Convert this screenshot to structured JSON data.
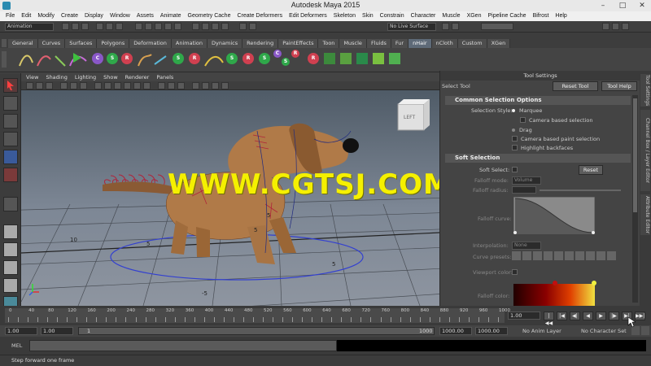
{
  "window": {
    "title": "Autodesk Maya 2015",
    "minimize": "–",
    "maximize": "□",
    "close": "✕"
  },
  "menubar": [
    "File",
    "Edit",
    "Modify",
    "Create",
    "Display",
    "Window",
    "Assets",
    "Animate",
    "Geometry Cache",
    "Create Deformers",
    "Edit Deformers",
    "Skeleton",
    "Skin",
    "Constrain",
    "Character",
    "Muscle",
    "XGen",
    "Pipeline Cache",
    "Bifrost",
    "Help"
  ],
  "statusline": {
    "menuset": "Animation",
    "live_surface": "No Live Surface"
  },
  "shelf": {
    "tabs": [
      "General",
      "Curves",
      "Surfaces",
      "Polygons",
      "Deformation",
      "Animation",
      "Dynamics",
      "Rendering",
      "PaintEffects",
      "Toon",
      "Muscle",
      "Fluids",
      "Fur",
      "nHair",
      "nCloth",
      "Custom",
      "XGen"
    ],
    "active_tab": "nHair",
    "icon_letters": [
      "C",
      "S",
      "R",
      "S",
      "R",
      "S",
      "R",
      "S",
      "C",
      "S",
      "R",
      "R"
    ]
  },
  "viewport": {
    "menu": [
      "View",
      "Shading",
      "Lighting",
      "Show",
      "Renderer",
      "Panels"
    ],
    "viewcube_label": "LEFT",
    "grid_labels": [
      "10",
      "5",
      "5",
      "-5",
      "5",
      "5"
    ],
    "watermark": "WWW.CGTSJ.COM"
  },
  "tool_settings": {
    "panel_title": "Tool Settings",
    "tool_name": "Select Tool",
    "reset_tool": "Reset Tool",
    "tool_help": "Tool Help",
    "common_section": "Common Selection Options",
    "selection_style_label": "Selection Style:",
    "marquee": "Marquee",
    "camera_based_selection": "Camera based selection",
    "drag": "Drag",
    "camera_based_paint": "Camera based paint selection",
    "highlight_backfaces": "Highlight backfaces",
    "soft_section": "Soft Selection",
    "soft_select": "Soft Select:",
    "reset": "Reset",
    "falloff_mode": "Falloff mode:",
    "falloff_mode_value": "Volume",
    "falloff_radius": "Falloff radius:",
    "falloff_curve": "Falloff curve:",
    "interpolation": "Interpolation:",
    "interpolation_value": "None",
    "curve_presets": "Curve presets:",
    "viewport_color": "Viewport color:",
    "falloff_color": "Falloff color:"
  },
  "side_tabs": [
    "Tool Settings",
    "Channel Box / Layer Editor",
    "Attribute Editor"
  ],
  "timeline": {
    "ticks": [
      "0",
      "20",
      "40",
      "60",
      "80",
      "100",
      "120",
      "140",
      "160",
      "180",
      "200",
      "220",
      "240",
      "260",
      "280",
      "300",
      "320",
      "340",
      "360",
      "380",
      "400",
      "420",
      "440",
      "460",
      "480",
      "500",
      "520",
      "540",
      "560",
      "580",
      "600",
      "620",
      "640",
      "660",
      "680",
      "700",
      "720",
      "740",
      "760",
      "780",
      "800",
      "820",
      "840",
      "860",
      "880",
      "900",
      "920",
      "940",
      "960",
      "980",
      "1000"
    ],
    "current_frame": "1.00"
  },
  "range": {
    "start": "1.00",
    "start2": "1.00",
    "range_start": "1",
    "range_end": "1000",
    "end": "1000.00",
    "end2": "1000.00",
    "anim_layer": "No Anim Layer",
    "character_set": "No Character Set"
  },
  "cmdline": {
    "label": "MEL"
  },
  "helpline": {
    "text": "Step forward one frame"
  }
}
